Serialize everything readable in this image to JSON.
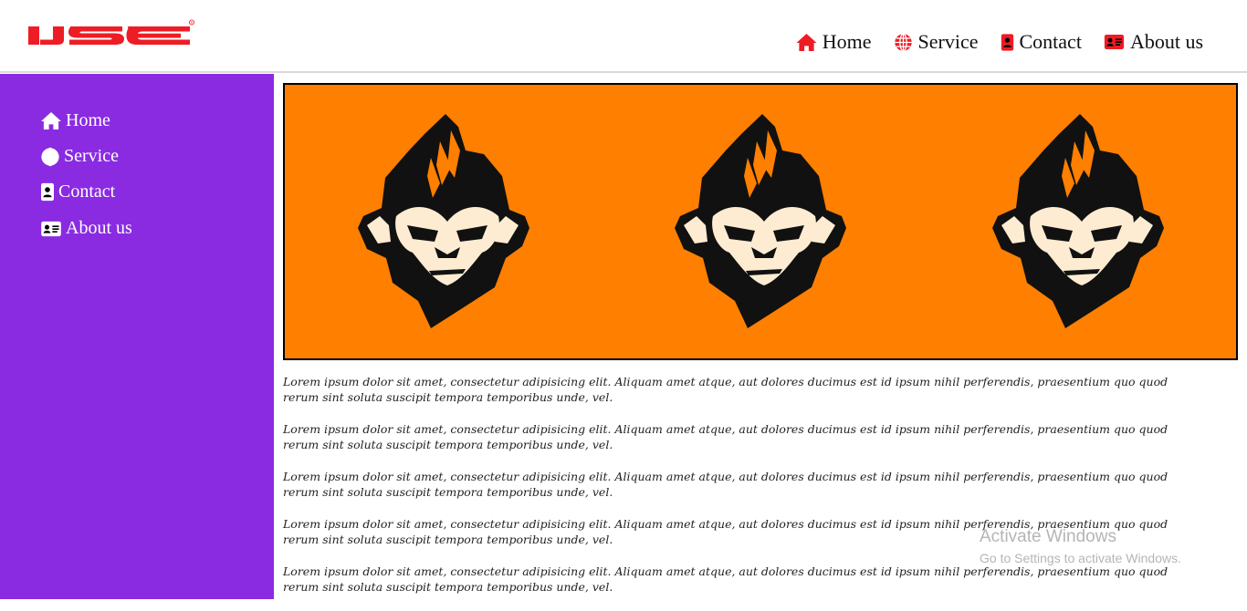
{
  "brand": {
    "logo_text": "IJSE",
    "accent": "#ee1c25"
  },
  "colors": {
    "sidebar": "#8a2be2",
    "banner": "#ff7f00",
    "monkey_fill": "#111111",
    "monkey_face": "#fdecd2"
  },
  "top_nav": [
    {
      "label": "Home",
      "icon": "home-icon"
    },
    {
      "label": "Service",
      "icon": "globe-icon"
    },
    {
      "label": "Contact",
      "icon": "contact-badge-icon"
    },
    {
      "label": "About us",
      "icon": "id-card-icon"
    }
  ],
  "sidebar": {
    "items": [
      {
        "label": "Home",
        "icon": "home-icon"
      },
      {
        "label": "Service",
        "icon": "globe-icon"
      },
      {
        "label": "Contact",
        "icon": "contact-badge-icon"
      },
      {
        "label": "About us",
        "icon": "id-card-icon"
      }
    ]
  },
  "banner": {
    "image": "monkey-logo",
    "count": 3
  },
  "paragraphs": [
    "Lorem ipsum dolor sit amet, consectetur adipisicing elit. Aliquam amet atque, aut dolores ducimus est id ipsum nihil perferendis, praesentium quo quod rerum sint soluta suscipit tempora temporibus unde, vel.",
    "Lorem ipsum dolor sit amet, consectetur adipisicing elit. Aliquam amet atque, aut dolores ducimus est id ipsum nihil perferendis, praesentium quo quod rerum sint soluta suscipit tempora temporibus unde, vel.",
    "Lorem ipsum dolor sit amet, consectetur adipisicing elit. Aliquam amet atque, aut dolores ducimus est id ipsum nihil perferendis, praesentium quo quod rerum sint soluta suscipit tempora temporibus unde, vel.",
    "Lorem ipsum dolor sit amet, consectetur adipisicing elit. Aliquam amet atque, aut dolores ducimus est id ipsum nihil perferendis, praesentium quo quod rerum sint soluta suscipit tempora temporibus unde, vel.",
    "Lorem ipsum dolor sit amet, consectetur adipisicing elit. Aliquam amet atque, aut dolores ducimus est id ipsum nihil perferendis, praesentium quo quod rerum sint soluta suscipit tempora temporibus unde, vel."
  ],
  "watermark": {
    "title": "Activate Windows",
    "subtitle": "Go to Settings to activate Windows."
  }
}
